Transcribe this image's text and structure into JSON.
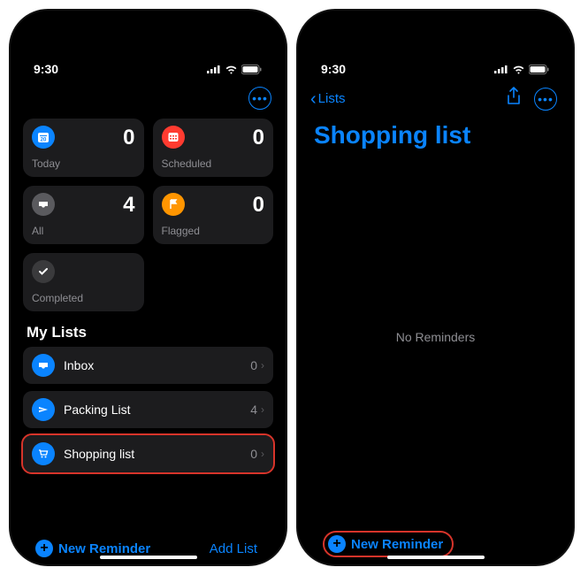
{
  "status": {
    "time": "9:30"
  },
  "left": {
    "cards": [
      {
        "label": "Today",
        "count": "0"
      },
      {
        "label": "Scheduled",
        "count": "0"
      },
      {
        "label": "All",
        "count": "4"
      },
      {
        "label": "Flagged",
        "count": "0"
      },
      {
        "label": "Completed",
        "count": ""
      }
    ],
    "section_title": "My Lists",
    "lists": [
      {
        "label": "Inbox",
        "count": "0"
      },
      {
        "label": "Packing List",
        "count": "4"
      },
      {
        "label": "Shopping list",
        "count": "0"
      }
    ],
    "new_reminder": "New Reminder",
    "add_list": "Add List"
  },
  "right": {
    "back_label": "Lists",
    "title": "Shopping list",
    "empty_text": "No Reminders",
    "new_reminder": "New Reminder"
  }
}
